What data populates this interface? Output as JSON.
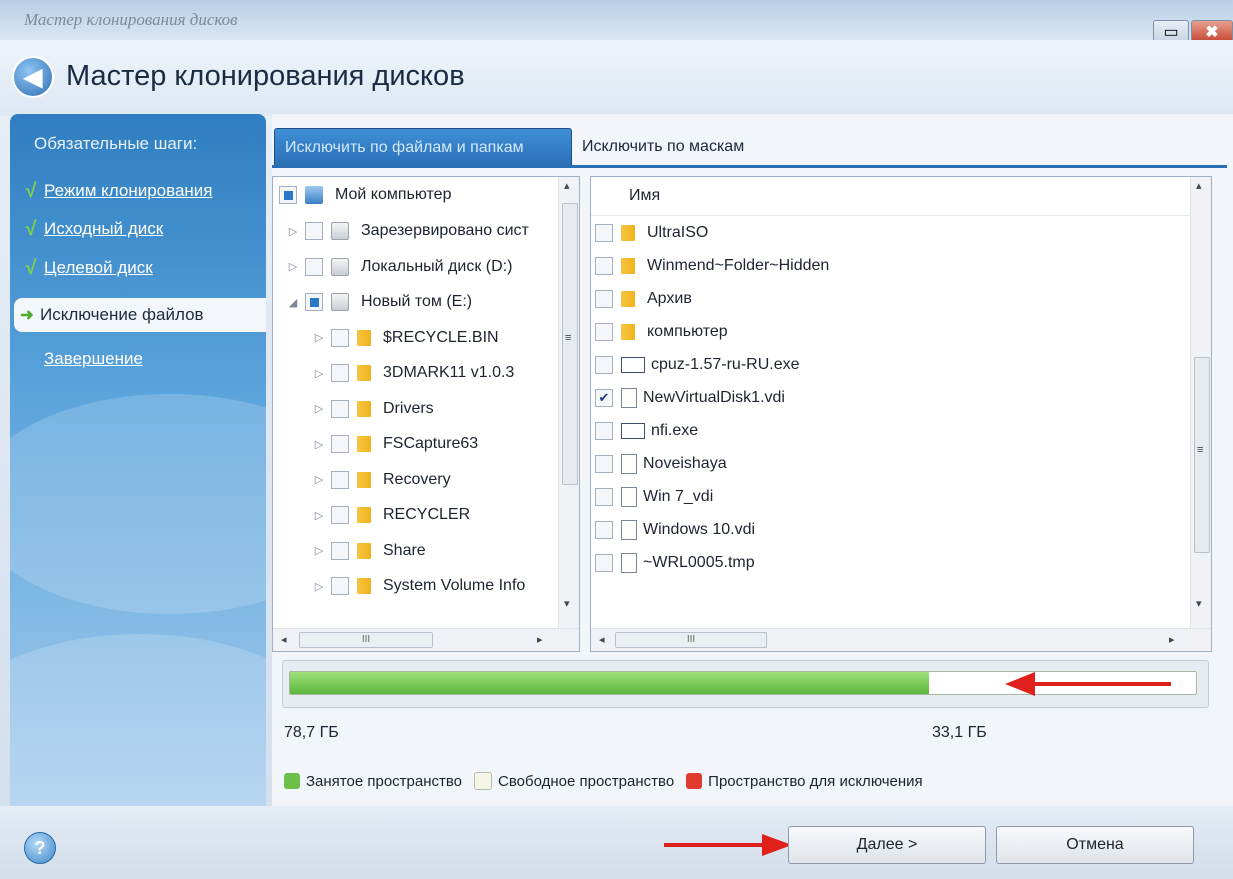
{
  "window": {
    "title": "Мастер клонирования дисков",
    "close_glyph": "✖",
    "restore_glyph": "▭"
  },
  "header": {
    "title": "Мастер клонирования дисков"
  },
  "sidebar": {
    "steps_title": "Обязательные шаги:",
    "steps": [
      {
        "label": "Режим клонирования",
        "status": "done",
        "glyph": "√"
      },
      {
        "label": "Исходный диск",
        "status": "done",
        "glyph": "√"
      },
      {
        "label": "Целевой диск",
        "status": "done",
        "glyph": "√"
      },
      {
        "label": "Исключение файлов",
        "status": "active",
        "glyph": "➜"
      },
      {
        "label": "Завершение",
        "status": "pending",
        "glyph": ""
      }
    ]
  },
  "tabs": [
    {
      "label": "Исключить по файлам и папкам",
      "active": true
    },
    {
      "label": "Исключить по маскам",
      "active": false
    }
  ],
  "tree": {
    "root": "Мой компьютер",
    "items": [
      {
        "label": "Зарезервировано сист",
        "type": "drive",
        "level": 1,
        "state": "unchecked",
        "expander": "▷"
      },
      {
        "label": "Локальный диск (D:)",
        "type": "drive",
        "level": 1,
        "state": "unchecked",
        "expander": "▷"
      },
      {
        "label": "Новый том (E:)",
        "type": "drive",
        "level": 1,
        "state": "partial",
        "expander": "◢"
      },
      {
        "label": "$RECYCLE.BIN",
        "type": "folder",
        "level": 2,
        "state": "unchecked",
        "expander": "▷"
      },
      {
        "label": "3DMARK11 v1.0.3",
        "type": "folder",
        "level": 2,
        "state": "unchecked",
        "expander": "▷"
      },
      {
        "label": "Drivers",
        "type": "folder",
        "level": 2,
        "state": "unchecked",
        "expander": "▷"
      },
      {
        "label": "FSCapture63",
        "type": "folder",
        "level": 2,
        "state": "unchecked",
        "expander": "▷"
      },
      {
        "label": "Recovery",
        "type": "folder",
        "level": 2,
        "state": "unchecked",
        "expander": "▷"
      },
      {
        "label": "RECYCLER",
        "type": "folder",
        "level": 2,
        "state": "unchecked",
        "expander": "▷"
      },
      {
        "label": "Share",
        "type": "folder",
        "level": 2,
        "state": "unchecked",
        "expander": "▷"
      },
      {
        "label": "System Volume Info",
        "type": "folder",
        "level": 2,
        "state": "unchecked",
        "expander": "▷"
      }
    ]
  },
  "filelist": {
    "column_header": "Имя",
    "items": [
      {
        "label": "UltraISO",
        "type": "folder",
        "checked": false
      },
      {
        "label": "Winmend~Folder~Hidden",
        "type": "folder",
        "checked": false
      },
      {
        "label": "Архив",
        "type": "folder",
        "checked": false
      },
      {
        "label": "компьютер",
        "type": "folder",
        "checked": false
      },
      {
        "label": "cpuz-1.57-ru-RU.exe",
        "type": "exe",
        "checked": false
      },
      {
        "label": "NewVirtualDisk1.vdi",
        "type": "file",
        "checked": true
      },
      {
        "label": "nfi.exe",
        "type": "exe",
        "checked": false
      },
      {
        "label": "Noveishaya",
        "type": "file",
        "checked": false
      },
      {
        "label": "Win 7_vdi",
        "type": "file",
        "checked": false
      },
      {
        "label": "Windows 10.vdi",
        "type": "file",
        "checked": false
      },
      {
        "label": "~WRL0005.tmp",
        "type": "file",
        "checked": false
      }
    ]
  },
  "scroll": {
    "up": "▴",
    "down": "▾",
    "left": "◂",
    "right": "▸",
    "grip": "≡",
    "hgrip": "III"
  },
  "usage": {
    "used_fraction": 0.705,
    "used_label": "78,7 ГБ",
    "free_label": "33,1 ГБ"
  },
  "legend": [
    {
      "label": "Занятое пространство",
      "color": "#6cc04a"
    },
    {
      "label": "Свободное пространство",
      "color": "#f5f6e8"
    },
    {
      "label": "Пространство для исключения",
      "color": "#e03b2e"
    }
  ],
  "buttons": {
    "next": "Далее >",
    "cancel": "Отмена",
    "help": "?"
  },
  "colors": {
    "accent": "#2a6fb6",
    "annotation_arrow": "#e0211b"
  }
}
